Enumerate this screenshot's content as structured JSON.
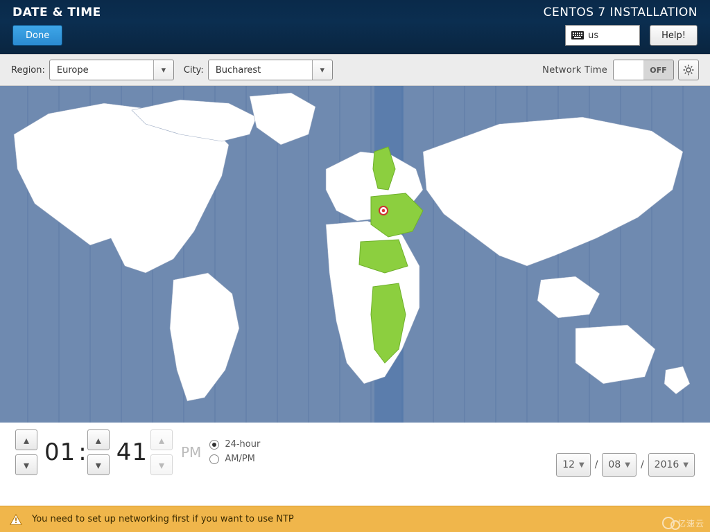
{
  "header": {
    "title": "DATE & TIME",
    "installer": "CENTOS 7 INSTALLATION",
    "done": "Done",
    "help": "Help!",
    "keyboard_layout": "us"
  },
  "toolbar": {
    "region_label": "Region:",
    "region_value": "Europe",
    "city_label": "City:",
    "city_value": "Bucharest",
    "network_time_label": "Network Time",
    "network_time_state": "OFF"
  },
  "time": {
    "hours": "01",
    "sep": ":",
    "minutes": "41",
    "ampm": "PM",
    "fmt24": "24-hour",
    "fmtampm": "AM/PM",
    "selected_format": "24-hour"
  },
  "date": {
    "month": "12",
    "day": "08",
    "year": "2016",
    "sep": "/"
  },
  "warning": {
    "text": "You need to set up networking first if you want to use NTP"
  },
  "watermark": "亿速云"
}
